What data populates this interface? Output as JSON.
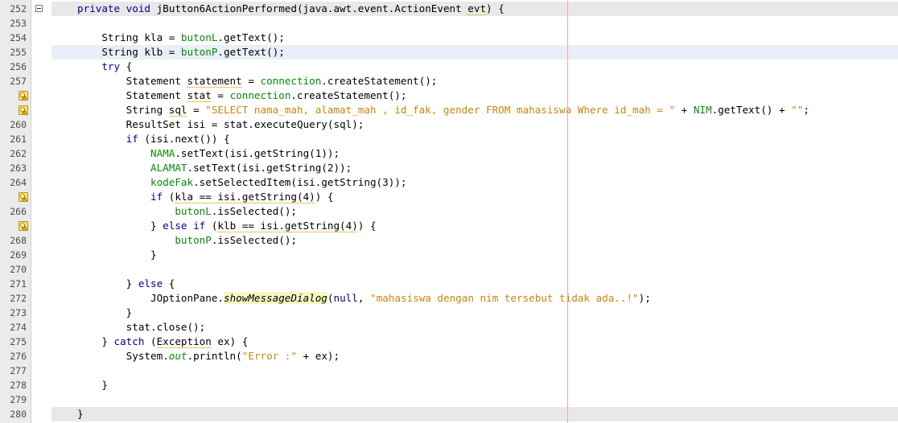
{
  "editor": {
    "lines": [
      {
        "num": "252",
        "fold": true,
        "hl": "gray",
        "segs": [
          [
            "kw",
            "private void "
          ],
          [
            "b",
            "jButton6ActionPerformed"
          ],
          [
            "t",
            "(java.awt.event.ActionEvent "
          ],
          [
            "u",
            "evt"
          ],
          [
            "t",
            ") {"
          ]
        ]
      },
      {
        "num": "253",
        "segs": []
      },
      {
        "num": "254",
        "segs": [
          [
            "t",
            "    String kla = "
          ],
          [
            "fld",
            "butonL"
          ],
          [
            "t",
            ".getText();"
          ]
        ]
      },
      {
        "num": "255",
        "hl": "blue",
        "segs": [
          [
            "t",
            "    String klb = "
          ],
          [
            "fld",
            "butonP"
          ],
          [
            "t",
            ".getText();"
          ]
        ]
      },
      {
        "num": "256",
        "segs": [
          [
            "kw",
            "    try"
          ],
          [
            "t",
            " {"
          ]
        ]
      },
      {
        "num": "257",
        "segs": [
          [
            "t",
            "        Statement "
          ],
          [
            "u",
            "statement"
          ],
          [
            "t",
            " = "
          ],
          [
            "fld",
            "connection"
          ],
          [
            "t",
            ".createStatement();"
          ]
        ]
      },
      {
        "num": "258",
        "warn": true,
        "segs": [
          [
            "t",
            "        Statement "
          ],
          [
            "u",
            "stat"
          ],
          [
            "t",
            " = "
          ],
          [
            "fld",
            "connection"
          ],
          [
            "t",
            ".createStatement();"
          ]
        ]
      },
      {
        "num": "259",
        "warn": true,
        "segs": [
          [
            "t",
            "        String "
          ],
          [
            "u",
            "sql"
          ],
          [
            "t",
            " = "
          ],
          [
            "str",
            "\"SELECT nama_mah, alamat_mah , id_fak, gender FROM mahasiswa Where id_mah = \""
          ],
          [
            "t",
            " + "
          ],
          [
            "fld",
            "NIM"
          ],
          [
            "t",
            ".getText() + "
          ],
          [
            "str",
            "\"\""
          ],
          [
            "t",
            ";"
          ]
        ]
      },
      {
        "num": "260",
        "segs": [
          [
            "t",
            "        ResultSet isi = stat.executeQuery(sql);"
          ]
        ]
      },
      {
        "num": "261",
        "segs": [
          [
            "kw",
            "        if"
          ],
          [
            "t",
            " (isi.next()) {"
          ]
        ]
      },
      {
        "num": "262",
        "segs": [
          [
            "t",
            "            "
          ],
          [
            "fld",
            "NAMA"
          ],
          [
            "t",
            ".setText(isi.getString(1));"
          ]
        ]
      },
      {
        "num": "263",
        "segs": [
          [
            "t",
            "            "
          ],
          [
            "fld",
            "ALAMAT"
          ],
          [
            "t",
            ".setText(isi.getString(2));"
          ]
        ]
      },
      {
        "num": "264",
        "segs": [
          [
            "t",
            "            "
          ],
          [
            "fld",
            "kodeFak"
          ],
          [
            "t",
            ".setSelectedItem(isi.getString(3));"
          ]
        ]
      },
      {
        "num": "265",
        "warn": true,
        "segs": [
          [
            "kw",
            "            if"
          ],
          [
            "t",
            " ("
          ],
          [
            "u",
            "kla == isi.getString(4)"
          ],
          [
            "t",
            ") {"
          ]
        ]
      },
      {
        "num": "266",
        "segs": [
          [
            "t",
            "                "
          ],
          [
            "fld",
            "butonL"
          ],
          [
            "t",
            ".isSelected();"
          ]
        ]
      },
      {
        "num": "267",
        "warn": true,
        "segs": [
          [
            "t",
            "            } "
          ],
          [
            "kw",
            "else if"
          ],
          [
            "t",
            " ("
          ],
          [
            "u",
            "klb == isi.getString(4)"
          ],
          [
            "t",
            ") {"
          ]
        ]
      },
      {
        "num": "268",
        "segs": [
          [
            "t",
            "                "
          ],
          [
            "fld",
            "butonP"
          ],
          [
            "t",
            ".isSelected();"
          ]
        ]
      },
      {
        "num": "269",
        "segs": [
          [
            "t",
            "            }"
          ]
        ]
      },
      {
        "num": "270",
        "segs": []
      },
      {
        "num": "271",
        "segs": [
          [
            "t",
            "        } "
          ],
          [
            "kw",
            "else"
          ],
          [
            "t",
            " {"
          ]
        ]
      },
      {
        "num": "272",
        "segs": [
          [
            "t",
            "            JOptionPane."
          ],
          [
            "mk",
            "showMessageDialog"
          ],
          [
            "t",
            "("
          ],
          [
            "kw",
            "null"
          ],
          [
            "t",
            ", "
          ],
          [
            "str",
            "\"mahasiswa dengan nim tersebut tidak ada..!\""
          ],
          [
            "t",
            ");"
          ]
        ]
      },
      {
        "num": "273",
        "segs": [
          [
            "t",
            "        }"
          ]
        ]
      },
      {
        "num": "274",
        "segs": [
          [
            "t",
            "        stat.close();"
          ]
        ]
      },
      {
        "num": "275",
        "segs": [
          [
            "t",
            "    } "
          ],
          [
            "kw",
            "catch"
          ],
          [
            "t",
            " ("
          ],
          [
            "u",
            "Exception"
          ],
          [
            "t",
            " ex) {"
          ]
        ]
      },
      {
        "num": "276",
        "segs": [
          [
            "t",
            "        System."
          ],
          [
            "itf",
            "out"
          ],
          [
            "t",
            ".println("
          ],
          [
            "str",
            "\"Error :\""
          ],
          [
            "t",
            " + ex);"
          ]
        ]
      },
      {
        "num": "277",
        "segs": []
      },
      {
        "num": "278",
        "segs": [
          [
            "t",
            "    }"
          ]
        ]
      },
      {
        "num": "279",
        "segs": []
      },
      {
        "num": "280",
        "hl": "gray",
        "segs": [
          [
            "t",
            "}"
          ]
        ]
      }
    ]
  },
  "colors": {
    "keyword": "#00008b",
    "string": "#c8860a",
    "field": "#0a8a0a",
    "gutter": "#ebebeb",
    "margin": "#f0a8a8"
  },
  "icons": {
    "warning": "warning-bulb-icon",
    "fold": "fold-collapse-icon"
  }
}
